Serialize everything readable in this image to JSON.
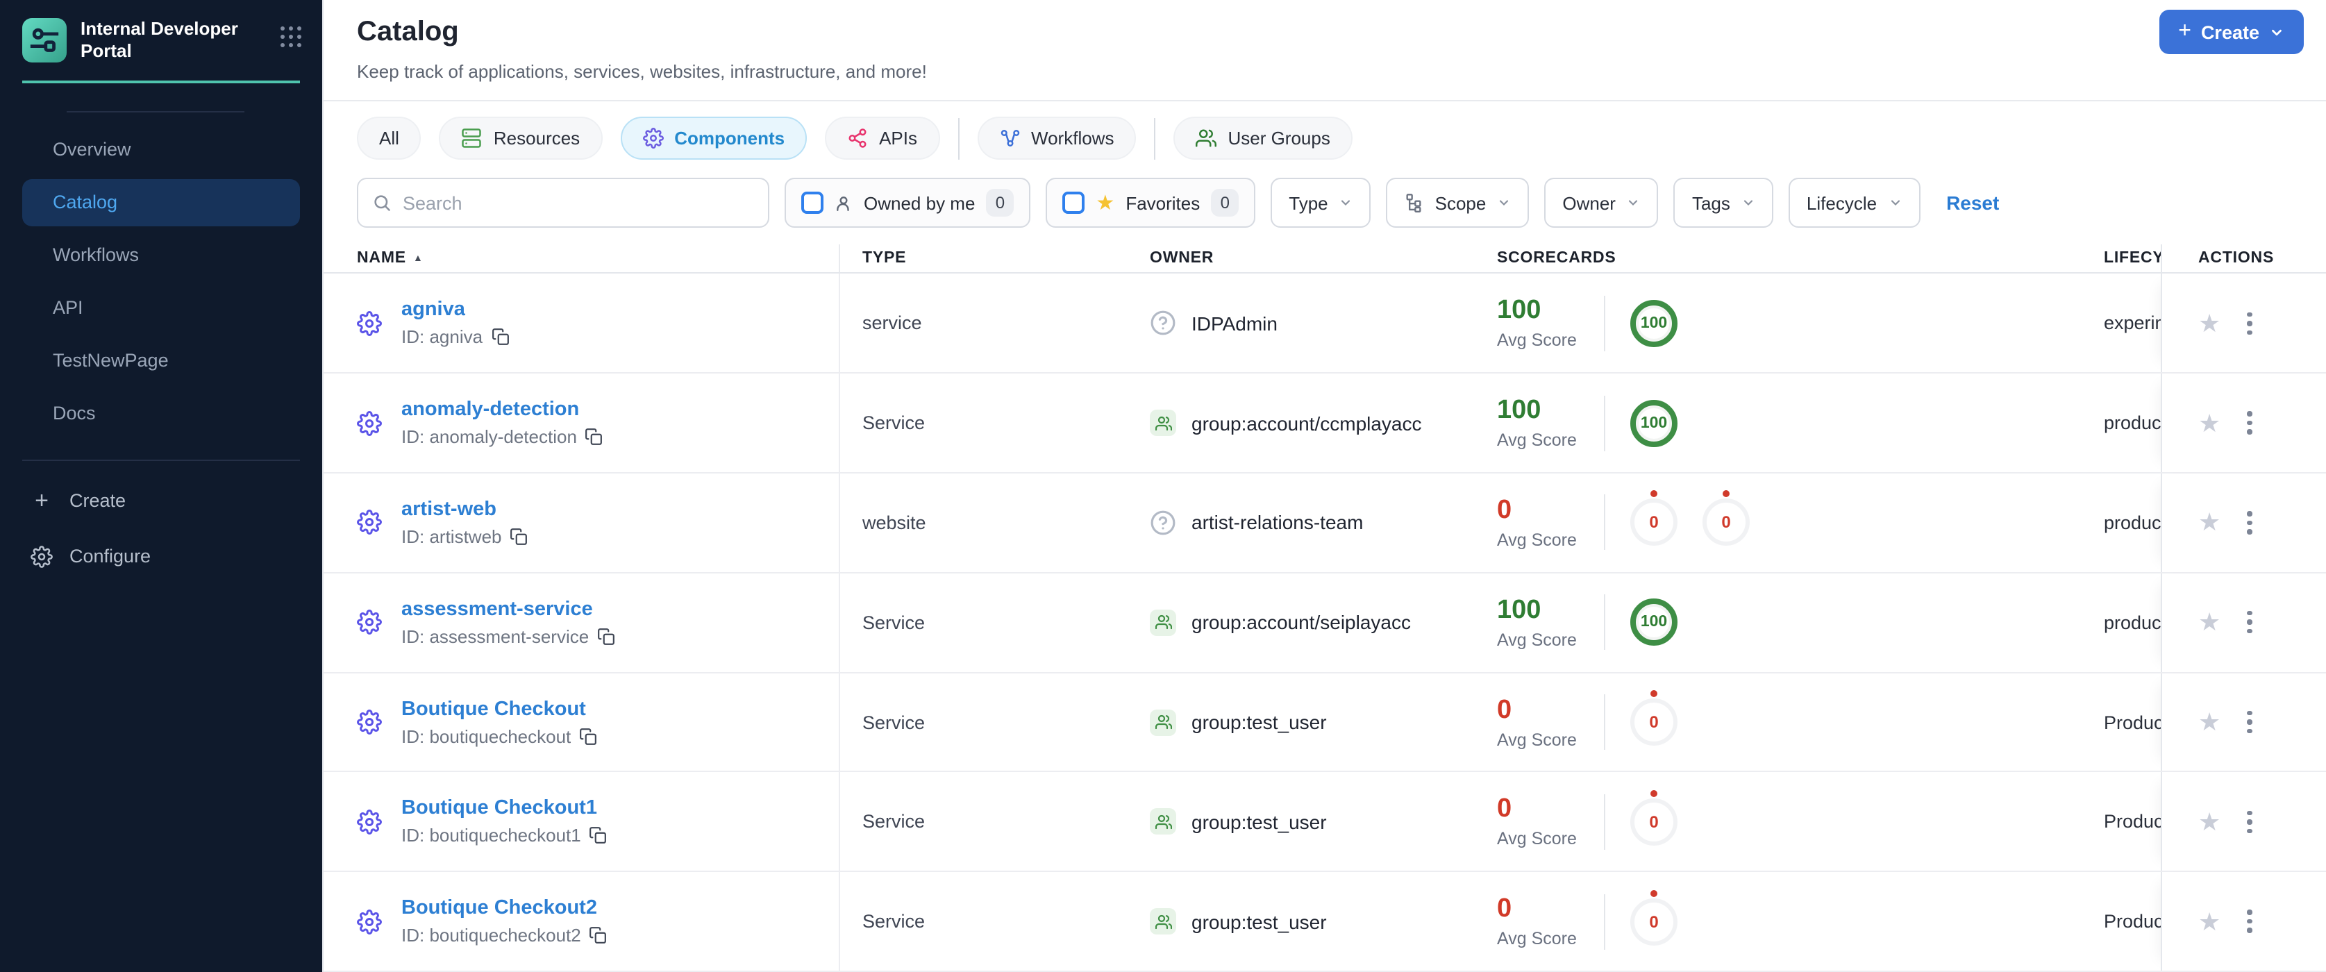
{
  "sidebar": {
    "brand_title": "Internal Developer Portal",
    "nav": [
      {
        "label": "Overview",
        "active": false
      },
      {
        "label": "Catalog",
        "active": true
      },
      {
        "label": "Workflows",
        "active": false
      },
      {
        "label": "API",
        "active": false
      },
      {
        "label": "TestNewPage",
        "active": false
      },
      {
        "label": "Docs",
        "active": false
      }
    ],
    "actions": {
      "create_label": "Create",
      "configure_label": "Configure"
    }
  },
  "header": {
    "title": "Catalog",
    "subtitle": "Keep track of applications, services, websites, infrastructure, and more!",
    "create_button_label": "Create"
  },
  "tabs": [
    {
      "label": "All",
      "icon": "none",
      "active": false
    },
    {
      "label": "Resources",
      "icon": "resources-icon",
      "active": false
    },
    {
      "label": "Components",
      "icon": "components-gear-icon",
      "active": true
    },
    {
      "label": "APIs",
      "icon": "apis-icon",
      "active": false
    },
    {
      "label": "Workflows",
      "icon": "workflows-icon",
      "active": false
    },
    {
      "label": "User Groups",
      "icon": "user-groups-icon",
      "active": false
    }
  ],
  "filters": {
    "search_placeholder": "Search",
    "owned_by_me": {
      "label": "Owned by me",
      "count": "0"
    },
    "favorites": {
      "label": "Favorites",
      "count": "0"
    },
    "type_label": "Type",
    "scope_label": "Scope",
    "owner_label": "Owner",
    "tags_label": "Tags",
    "lifecycle_label": "Lifecycle",
    "reset_label": "Reset"
  },
  "table": {
    "columns": {
      "name": "NAME",
      "type": "TYPE",
      "owner": "OWNER",
      "scorecards": "SCORECARDS",
      "lifecycle": "LIFECYCLE",
      "actions": "ACTIONS"
    },
    "avg_score_label": "Avg Score",
    "rows": [
      {
        "name": "agniva",
        "id_label": "ID: agniva",
        "type": "service",
        "owner": {
          "kind": "unknown",
          "name": "IDPAdmin"
        },
        "score": {
          "value": "100",
          "color": "green"
        },
        "rings": [
          {
            "value": "100",
            "color": "green"
          }
        ],
        "lifecycle": "experimental"
      },
      {
        "name": "anomaly-detection",
        "id_label": "ID: anomaly-detection",
        "type": "Service",
        "owner": {
          "kind": "group",
          "name": "group:account/ccmplayacc"
        },
        "score": {
          "value": "100",
          "color": "green"
        },
        "rings": [
          {
            "value": "100",
            "color": "green"
          }
        ],
        "lifecycle": "production"
      },
      {
        "name": "artist-web",
        "id_label": "ID: artistweb",
        "type": "website",
        "owner": {
          "kind": "unknown",
          "name": "artist-relations-team"
        },
        "score": {
          "value": "0",
          "color": "red"
        },
        "rings": [
          {
            "value": "0",
            "color": "red"
          },
          {
            "value": "0",
            "color": "red"
          }
        ],
        "lifecycle": "production"
      },
      {
        "name": "assessment-service",
        "id_label": "ID: assessment-service",
        "type": "Service",
        "owner": {
          "kind": "group",
          "name": "group:account/seiplayacc"
        },
        "score": {
          "value": "100",
          "color": "green"
        },
        "rings": [
          {
            "value": "100",
            "color": "green"
          }
        ],
        "lifecycle": "production"
      },
      {
        "name": "Boutique Checkout",
        "id_label": "ID: boutiquecheckout",
        "type": "Service",
        "owner": {
          "kind": "group",
          "name": "group:test_user"
        },
        "score": {
          "value": "0",
          "color": "red"
        },
        "rings": [
          {
            "value": "0",
            "color": "red"
          }
        ],
        "lifecycle": "Production"
      },
      {
        "name": "Boutique Checkout1",
        "id_label": "ID: boutiquecheckout1",
        "type": "Service",
        "owner": {
          "kind": "group",
          "name": "group:test_user"
        },
        "score": {
          "value": "0",
          "color": "red"
        },
        "rings": [
          {
            "value": "0",
            "color": "red"
          }
        ],
        "lifecycle": "Production"
      },
      {
        "name": "Boutique Checkout2",
        "id_label": "ID: boutiquecheckout2",
        "type": "Service",
        "owner": {
          "kind": "group",
          "name": "group:test_user"
        },
        "score": {
          "value": "0",
          "color": "red"
        },
        "rings": [
          {
            "value": "0",
            "color": "red"
          }
        ],
        "lifecycle": "Production"
      }
    ]
  }
}
